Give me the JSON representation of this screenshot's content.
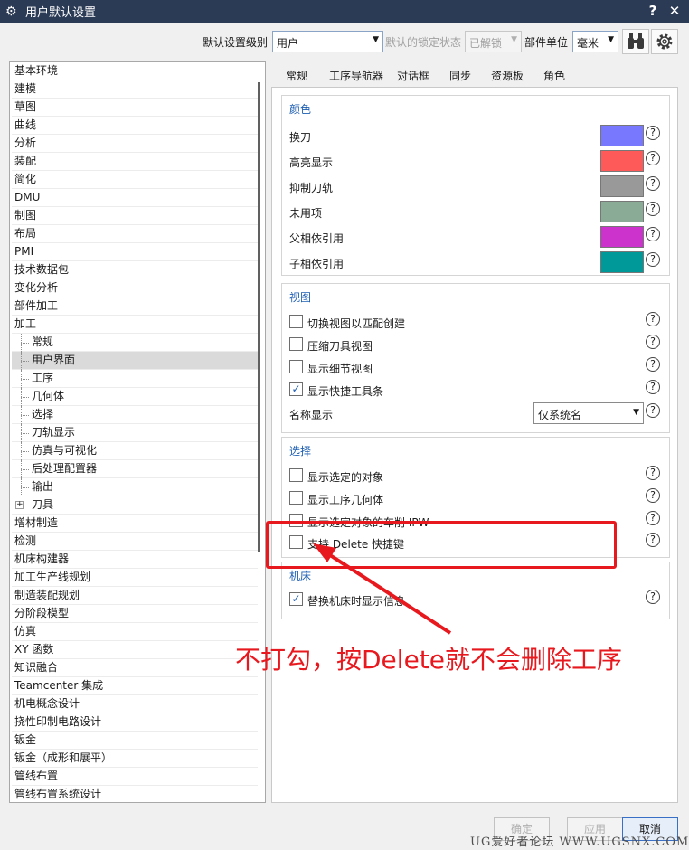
{
  "window": {
    "title": "用户默认设置",
    "help": "?",
    "close": "✕",
    "gear": "⚙"
  },
  "toolbar": {
    "level_label": "默认设置级别",
    "level_value": "用户",
    "lock_label": "默认的锁定状态",
    "lock_value": "已解锁",
    "unit_label": "部件单位",
    "unit_value": "毫米"
  },
  "tree": {
    "items": [
      {
        "label": "基本环境"
      },
      {
        "label": "建模"
      },
      {
        "label": "草图"
      },
      {
        "label": "曲线"
      },
      {
        "label": "分析"
      },
      {
        "label": "装配"
      },
      {
        "label": "简化"
      },
      {
        "label": "DMU"
      },
      {
        "label": "制图"
      },
      {
        "label": "布局"
      },
      {
        "label": "PMI"
      },
      {
        "label": "技术数据包"
      },
      {
        "label": "变化分析"
      },
      {
        "label": "部件加工"
      },
      {
        "label": "加工"
      },
      {
        "label": "常规"
      },
      {
        "label": "用户界面"
      },
      {
        "label": "工序"
      },
      {
        "label": "几何体"
      },
      {
        "label": "选择"
      },
      {
        "label": "刀轨显示"
      },
      {
        "label": "仿真与可视化"
      },
      {
        "label": "后处理配置器"
      },
      {
        "label": "输出"
      },
      {
        "label": "刀具"
      },
      {
        "label": "增材制造"
      },
      {
        "label": "检测"
      },
      {
        "label": "机床构建器"
      },
      {
        "label": "加工生产线规划"
      },
      {
        "label": "制造装配规划"
      },
      {
        "label": "分阶段模型"
      },
      {
        "label": "仿真"
      },
      {
        "label": "XY 函数"
      },
      {
        "label": "知识融合"
      },
      {
        "label": "Teamcenter 集成"
      },
      {
        "label": "机电概念设计"
      },
      {
        "label": "挠性印制电路设计"
      },
      {
        "label": "钣金"
      },
      {
        "label": "钣金（成形和展平）"
      },
      {
        "label": "管线布置"
      },
      {
        "label": "管线布置系统设计"
      }
    ],
    "selected": "用户界面",
    "expander": "+"
  },
  "tabs": [
    "常规",
    "工序导航器",
    "对话框",
    "同步",
    "资源板",
    "角色"
  ],
  "active_tab": "工序导航器",
  "colors_group": {
    "title": "颜色",
    "rows": [
      {
        "label": "换刀",
        "color": "#7878ff"
      },
      {
        "label": "高亮显示",
        "color": "#ff5a5a"
      },
      {
        "label": "抑制刀轨",
        "color": "#999999"
      },
      {
        "label": "未用项",
        "color": "#8aab96"
      },
      {
        "label": "父相依引用",
        "color": "#cc33cc"
      },
      {
        "label": "子相依引用",
        "color": "#00999a"
      }
    ]
  },
  "view_group": {
    "title": "视图",
    "checks": [
      {
        "label": "切换视图以匹配创建",
        "checked": false
      },
      {
        "label": "压缩刀具视图",
        "checked": false
      },
      {
        "label": "显示细节视图",
        "checked": false
      },
      {
        "label": "显示快捷工具条",
        "checked": true
      }
    ],
    "name_display_label": "名称显示",
    "name_display_value": "仅系统名"
  },
  "select_group": {
    "title": "选择",
    "checks": [
      {
        "label": "显示选定的对象",
        "checked": false
      },
      {
        "label": "显示工序几何体",
        "checked": false
      },
      {
        "label": "显示选定对象的车削 IPW",
        "checked": false
      },
      {
        "label": "支持 Delete 快捷键",
        "checked": false
      }
    ]
  },
  "machine_group": {
    "title": "机床",
    "checks": [
      {
        "label": "替换机床时显示信息",
        "checked": true
      }
    ]
  },
  "help_glyph": "?",
  "check_glyph": "✓",
  "arrow_glyph": "▼",
  "annotation": {
    "text": "不打勾，按Delete就不会删除工序",
    "color": "#e8191e"
  },
  "buttons": {
    "ok": "确定",
    "apply": "应用",
    "cancel": "取消"
  },
  "watermark": "UG爱好者论坛 WWW.UGSNX.COM"
}
